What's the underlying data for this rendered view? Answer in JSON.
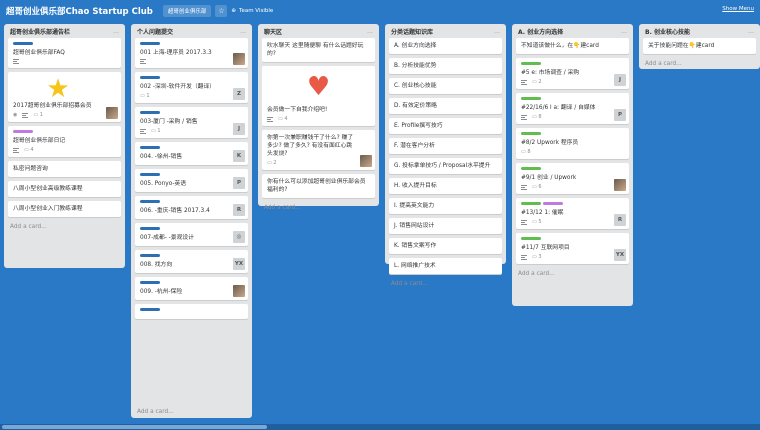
{
  "header": {
    "board_title": "超哥创业俱乐部Chao Startup Club",
    "pill_label": "超哥创业俱乐部",
    "visibility": "Team Visible",
    "menu_label": "Show Menu"
  },
  "colors": {
    "board_bg": "#2a79c6",
    "label_blue": "#2e6fb4",
    "label_purple": "#c377e0",
    "label_green": "#61bd4f"
  },
  "lists": [
    {
      "title": "超哥创业俱乐部通告栏",
      "add_card": "Add a card...",
      "cards": [
        {
          "labels": [
            "#2e6fb4"
          ],
          "text": "超哥创业俱乐部FAQ",
          "badges": {
            "desc": true
          }
        },
        {
          "cover": "star",
          "text": "2017超哥创业俱乐部招募会员",
          "badges": {
            "watch": true,
            "desc": true,
            "comments": "1"
          },
          "avatar": "photo"
        },
        {
          "labels": [
            "#c377e0"
          ],
          "text": "超哥创业俱乐部日记",
          "badges": {
            "desc": true,
            "comments": "4"
          }
        },
        {
          "text": "私密问题咨询"
        },
        {
          "text": "八周小型创业高级教练课程"
        },
        {
          "text": "八周小型创业入门教练课程"
        }
      ]
    },
    {
      "title": "个人问题提交",
      "add_card": "Add a card...",
      "cards": [
        {
          "labels": [
            "#2e6fb4"
          ],
          "text": "001    上海-理序员 2017.3.3",
          "badges": {
            "desc": true
          },
          "avatar": "photo"
        },
        {
          "labels": [
            "#2e6fb4"
          ],
          "text": "002    -深圳-软件开发（翻译）",
          "badges": {
            "comments": "1"
          },
          "avatar": "Z"
        },
        {
          "labels": [
            "#2e6fb4"
          ],
          "text": "003-厦门       -采购 / 销售",
          "badges": {
            "desc": true,
            "comments": "1"
          },
          "avatar": "J"
        },
        {
          "labels": [
            "#2e6fb4"
          ],
          "text": "004.       -徐州-销售",
          "avatar": "K"
        },
        {
          "labels": [
            "#2e6fb4"
          ],
          "text": "005. Ponyo-英语",
          "avatar": "P"
        },
        {
          "labels": [
            "#2e6fb4"
          ],
          "text": "006.       -重庆-销售 2017.3.4",
          "avatar": "R"
        },
        {
          "labels": [
            "#2e6fb4"
          ],
          "text": "007-成都-     -景观设计",
          "avatar": "ring"
        },
        {
          "labels": [
            "#2e6fb4"
          ],
          "text": "008.            找方向",
          "avatar": "YX"
        },
        {
          "labels": [
            "#2e6fb4"
          ],
          "text": "009.        -杭州-保险",
          "avatar": "photo"
        },
        {
          "labels": [
            "#2e6fb4"
          ],
          "text": ""
        }
      ]
    },
    {
      "title": "聊天区",
      "add_card": "Add a card...",
      "cards": [
        {
          "text": "吹水聊天 这里随便聊 有什么话题好玩的?"
        },
        {
          "cover": "heart",
          "text": "会员做一下自我介绍吧!",
          "badges": {
            "desc": true,
            "comments": "4"
          }
        },
        {
          "text": "你第一次兼职赚钱干了什么? 赚了多少? 做了多久? 有没有面红心跳头发烧?",
          "badges": {
            "comments": "2"
          },
          "avatar": "photo"
        },
        {
          "text": "你有什么可以添加超哥创业俱乐部会员福利的?"
        }
      ]
    },
    {
      "title": "分类话题知识库",
      "add_card": "Add a card...",
      "cards": [
        {
          "text": "A. 创业方向选择"
        },
        {
          "text": "B. 分析技能优势"
        },
        {
          "text": "C. 创业核心技能"
        },
        {
          "text": "D. 有效定价策略"
        },
        {
          "text": "E. Profile撰写技巧"
        },
        {
          "text": "F. 潜在客户分析"
        },
        {
          "text": "G. 投标拿单技巧 / Proposal水平提升"
        },
        {
          "text": "H. 收入提升目标"
        },
        {
          "text": "I. 提高英文能力"
        },
        {
          "text": "J. 销售网站设计"
        },
        {
          "text": "K. 销售文案写作"
        },
        {
          "text": "L. 网络推广技术"
        }
      ]
    },
    {
      "title": "A. 创业方向选择",
      "add_card": "Add a card...",
      "cards": [
        {
          "text": "不知道该做什么，在👇建card"
        },
        {
          "labels": [
            "#61bd4f"
          ],
          "text": "#5       e: 市场调查 / 采购",
          "badges": {
            "desc": true,
            "comments": "2"
          },
          "avatar": "J"
        },
        {
          "labels": [
            "#61bd4f"
          ],
          "text": "#22/16/6 l        a: 翻译 / 自媒体",
          "badges": {
            "desc": true,
            "comments": "8"
          },
          "avatar": "P"
        },
        {
          "labels": [
            "#61bd4f"
          ],
          "text": "#8/2        Upwork 程序员",
          "badges": {
            "comments": "8"
          }
        },
        {
          "labels": [
            "#61bd4f"
          ],
          "text": "#9/1          创业 / Upwork",
          "badges": {
            "desc": true,
            "comments": "6"
          },
          "avatar": "photo"
        },
        {
          "labels": [
            "#61bd4f",
            "#c377e0"
          ],
          "text": "#13/12       1: 催眠",
          "badges": {
            "desc": true,
            "comments": "5"
          },
          "avatar": "R"
        },
        {
          "labels": [
            "#61bd4f"
          ],
          "text": "#11/7           互联网项目",
          "badges": {
            "desc": true,
            "comments": "3"
          },
          "avatar": "YX"
        }
      ]
    },
    {
      "title": "B. 创业核心技能",
      "add_card": "Add a card...",
      "cards": [
        {
          "text": "关于技能问题在👇建card"
        }
      ]
    }
  ]
}
